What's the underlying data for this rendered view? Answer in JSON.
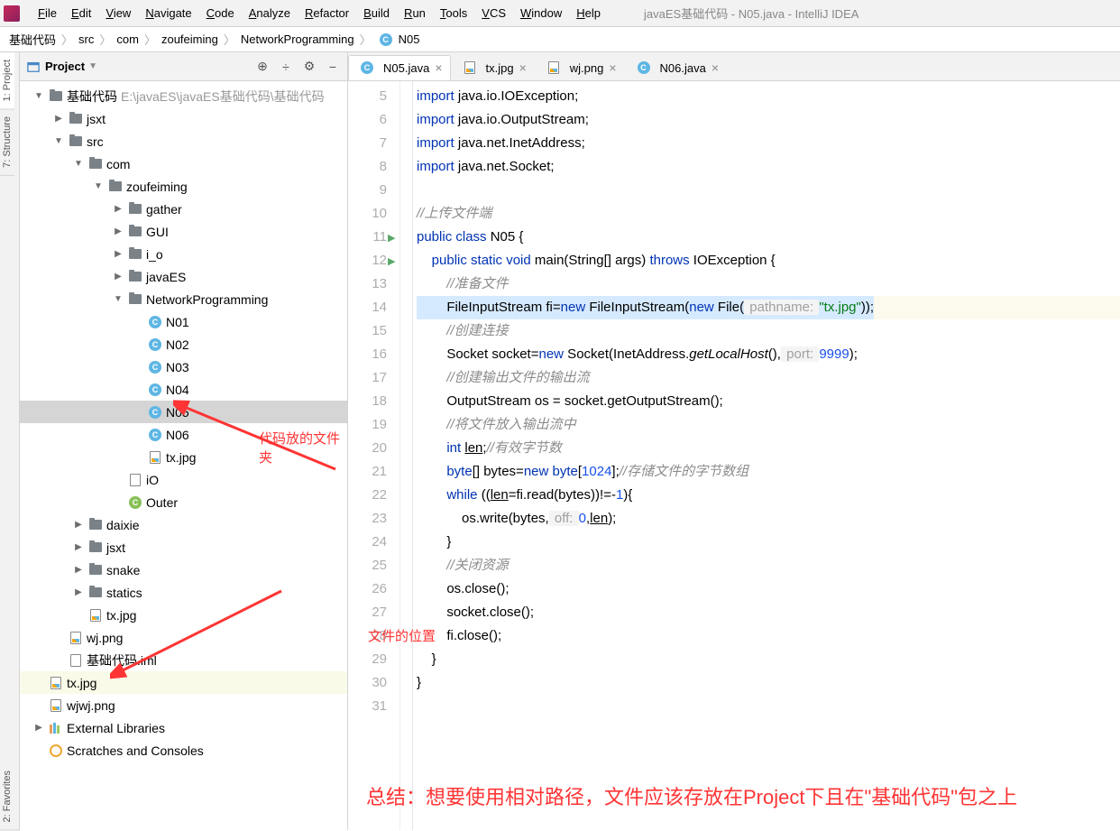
{
  "title": "javaES基础代码 - N05.java - IntelliJ IDEA",
  "menu": [
    "File",
    "Edit",
    "View",
    "Navigate",
    "Code",
    "Analyze",
    "Refactor",
    "Build",
    "Run",
    "Tools",
    "VCS",
    "Window",
    "Help"
  ],
  "breadcrumb": [
    "基础代码",
    "src",
    "com",
    "zoufeiming",
    "NetworkProgramming",
    "N05"
  ],
  "panel": {
    "title": "Project",
    "actions": [
      "⊕",
      "÷",
      "⚙",
      "−"
    ]
  },
  "tree": [
    {
      "indent": 0,
      "arrow": "▼",
      "icon": "folder",
      "label": "基础代码",
      "path": "E:\\javaES\\javaES基础代码\\基础代码"
    },
    {
      "indent": 1,
      "arrow": "▶",
      "icon": "folder",
      "label": "jsxt"
    },
    {
      "indent": 1,
      "arrow": "▼",
      "icon": "folder",
      "label": "src"
    },
    {
      "indent": 2,
      "arrow": "▼",
      "icon": "folder",
      "label": "com"
    },
    {
      "indent": 3,
      "arrow": "▼",
      "icon": "folder",
      "label": "zoufeiming"
    },
    {
      "indent": 4,
      "arrow": "▶",
      "icon": "folder",
      "label": "gather"
    },
    {
      "indent": 4,
      "arrow": "▶",
      "icon": "folder",
      "label": "GUI"
    },
    {
      "indent": 4,
      "arrow": "▶",
      "icon": "folder",
      "label": "i_o"
    },
    {
      "indent": 4,
      "arrow": "▶",
      "icon": "folder",
      "label": "javaES"
    },
    {
      "indent": 4,
      "arrow": "▼",
      "icon": "folder",
      "label": "NetworkProgramming"
    },
    {
      "indent": 5,
      "arrow": "",
      "icon": "java",
      "label": "N01"
    },
    {
      "indent": 5,
      "arrow": "",
      "icon": "java",
      "label": "N02"
    },
    {
      "indent": 5,
      "arrow": "",
      "icon": "java",
      "label": "N03"
    },
    {
      "indent": 5,
      "arrow": "",
      "icon": "java",
      "label": "N04"
    },
    {
      "indent": 5,
      "arrow": "",
      "icon": "java",
      "label": "N05",
      "selected": true
    },
    {
      "indent": 5,
      "arrow": "",
      "icon": "java",
      "label": "N06"
    },
    {
      "indent": 5,
      "arrow": "",
      "icon": "img",
      "label": "tx.jpg"
    },
    {
      "indent": 4,
      "arrow": "",
      "icon": "file",
      "label": "iO"
    },
    {
      "indent": 4,
      "arrow": "",
      "icon": "javag",
      "label": "Outer"
    },
    {
      "indent": 2,
      "arrow": "▶",
      "icon": "folder",
      "label": "daixie"
    },
    {
      "indent": 2,
      "arrow": "▶",
      "icon": "folder",
      "label": "jsxt"
    },
    {
      "indent": 2,
      "arrow": "▶",
      "icon": "folder",
      "label": "snake"
    },
    {
      "indent": 2,
      "arrow": "▶",
      "icon": "folder",
      "label": "statics"
    },
    {
      "indent": 2,
      "arrow": "",
      "icon": "img",
      "label": "tx.jpg"
    },
    {
      "indent": 1,
      "arrow": "",
      "icon": "img",
      "label": "wj.png"
    },
    {
      "indent": 1,
      "arrow": "",
      "icon": "file",
      "label": "基础代码.iml"
    },
    {
      "indent": 0,
      "arrow": "",
      "icon": "img",
      "label": "tx.jpg",
      "hl": true
    },
    {
      "indent": 0,
      "arrow": "",
      "icon": "img",
      "label": "wjwj.png"
    },
    {
      "indent": -1,
      "arrow": "▶",
      "icon": "lib",
      "label": "External Libraries"
    },
    {
      "indent": -1,
      "arrow": "",
      "icon": "scratch",
      "label": "Scratches and Consoles"
    }
  ],
  "tabs": [
    {
      "icon": "java",
      "label": "N05.java",
      "active": true
    },
    {
      "icon": "img",
      "label": "tx.jpg"
    },
    {
      "icon": "img",
      "label": "wj.png"
    },
    {
      "icon": "java",
      "label": "N06.java"
    }
  ],
  "side_tabs": [
    "1: Project",
    "7: Structure",
    "2: Favorites"
  ],
  "gutter_start": 5,
  "gutter_end": 31,
  "annotations": {
    "a1": "代码放的文件夹",
    "a2": "文件的位置",
    "summary": "总结：想要使用相对路径，文件应该存放在Project下且在\"基础代码\"包之上"
  },
  "code": {
    "l5": "import java.io.IOException;",
    "l6": "import java.io.OutputStream;",
    "l7": "import java.net.InetAddress;",
    "l8": "import java.net.Socket;",
    "l10": "//上传文件端",
    "l11_a": "public class ",
    "l11_b": "N05 {",
    "l12_a": "    public static void ",
    "l12_b": "main",
    "l12_c": "(String[] args) ",
    "l12_d": "throws ",
    "l12_e": "IOException {",
    "l13": "        //准备文件",
    "l14_a": "        FileInputStream fi=",
    "l14_b": "new ",
    "l14_c": "FileInputStream(",
    "l14_d": "new ",
    "l14_e": "File(",
    "l14_h": " pathname: ",
    "l14_f": "\"tx.jpg\"",
    "l14_g": "));",
    "l15": "        //创建连接",
    "l16_a": "        Socket socket=",
    "l16_b": "new ",
    "l16_c": "Socket(InetAddress.",
    "l16_d": "getLocalHost",
    "l16_e": "(),",
    "l16_h": " port: ",
    "l16_f": "9999",
    "l16_g": ");",
    "l17": "        //创建输出文件的输出流",
    "l18": "        OutputStream os = socket.getOutputStream();",
    "l19": "        //将文件放入输出流中",
    "l20_a": "        int ",
    "l20_b": "len",
    "l20_c": ";",
    "l20_d": "//有效字节数",
    "l21_a": "        byte",
    "l21_b": "[] bytes=",
    "l21_c": "new byte",
    "l21_d": "[",
    "l21_e": "1024",
    "l21_f": "];",
    "l21_g": "//存储文件的字节数组",
    "l22_a": "        while ",
    "l22_b": "((",
    "l22_c": "len",
    "l22_d": "=fi.read(bytes))!=-",
    "l22_e": "1",
    "l22_f": "){",
    "l23_a": "            os.write(bytes,",
    "l23_h": " off: ",
    "l23_b": "0",
    "l23_c": ",",
    "l23_d": "len",
    "l23_e": ");",
    "l24": "        }",
    "l25": "        //关闭资源",
    "l26": "        os.close();",
    "l27": "        socket.close();",
    "l28": "        fi.close();",
    "l29": "    }",
    "l30": "}"
  }
}
